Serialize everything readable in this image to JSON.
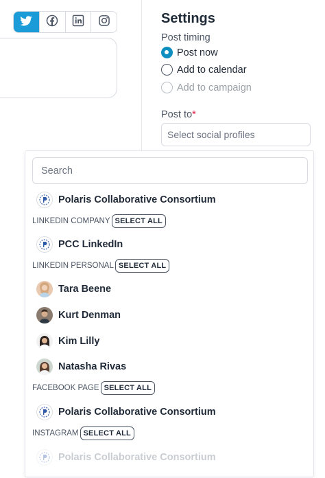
{
  "social_tabs": [
    {
      "icon": "twitter-icon",
      "active": true
    },
    {
      "icon": "facebook-icon",
      "active": false
    },
    {
      "icon": "linkedin-icon",
      "active": false
    },
    {
      "icon": "instagram-icon",
      "active": false
    }
  ],
  "settings": {
    "title": "Settings",
    "post_timing_label": "Post timing",
    "options": [
      {
        "label": "Post now",
        "selected": true,
        "disabled": false
      },
      {
        "label": "Add to calendar",
        "selected": false,
        "disabled": false
      },
      {
        "label": "Add to campaign",
        "selected": false,
        "disabled": true
      }
    ],
    "post_to_label": "Post to",
    "required_mark": "*",
    "profiles_placeholder": "Select social profiles"
  },
  "dropdown": {
    "search_placeholder": "Search",
    "top_item": {
      "name": "Polaris Collaborative Consortium",
      "avatar": "polaris-logo"
    },
    "groups": [
      {
        "label": "LINKEDIN COMPANY",
        "select_all": "SELECT ALL",
        "items": [
          {
            "name": "PCC LinkedIn",
            "avatar": "polaris-logo"
          }
        ]
      },
      {
        "label": "LINKEDIN PERSONAL",
        "select_all": "SELECT ALL",
        "items": [
          {
            "name": "Tara Beene",
            "avatar": "person-photo"
          },
          {
            "name": "Kurt Denman",
            "avatar": "person-photo"
          },
          {
            "name": "Kim Lilly",
            "avatar": "person-photo"
          },
          {
            "name": "Natasha Rivas",
            "avatar": "person-photo"
          }
        ]
      },
      {
        "label": "FACEBOOK PAGE",
        "select_all": "SELECT ALL",
        "items": [
          {
            "name": "Polaris Collaborative Consortium",
            "avatar": "polaris-logo"
          }
        ]
      },
      {
        "label": "INSTAGRAM",
        "select_all": "SELECT ALL",
        "items": [
          {
            "name": "Polaris Collaborative Consortium",
            "avatar": "polaris-logo",
            "faded": true
          }
        ]
      }
    ]
  },
  "colors": {
    "accent": "#1b9bd7",
    "radio_selected": "#0e8fbf",
    "required": "#e11d48"
  }
}
